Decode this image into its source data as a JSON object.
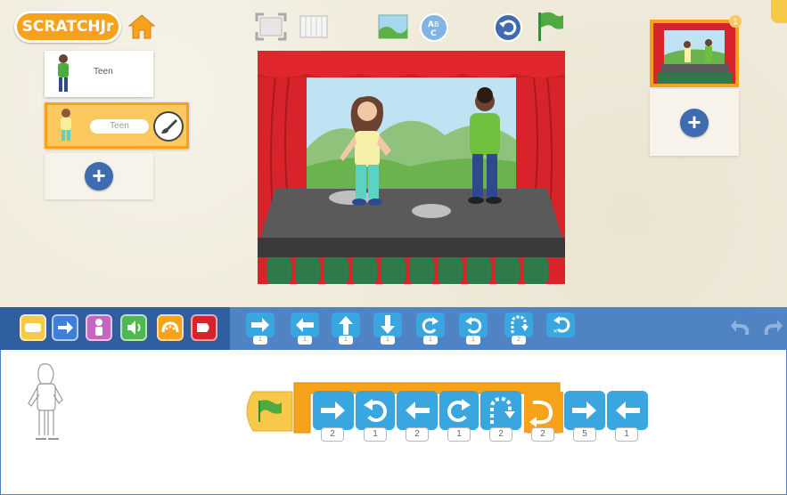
{
  "app": {
    "logo_text": "SCRATCHJr"
  },
  "toolbar": {
    "icons": [
      "home-icon",
      "fullscreen-icon",
      "grid-icon",
      "background-icon",
      "text-icon",
      "reset-icon",
      "green-flag-icon"
    ]
  },
  "sprites": {
    "items": [
      {
        "label": "Teen",
        "selected": false
      },
      {
        "label": "Teen",
        "selected": true
      }
    ]
  },
  "pages": {
    "current_page": "1"
  },
  "palette": {
    "categories": [
      {
        "name": "triggering-blocks",
        "color": "#f7c948"
      },
      {
        "name": "motion-blocks",
        "color": "#3f7fd8"
      },
      {
        "name": "looks-blocks",
        "color": "#c466c2"
      },
      {
        "name": "sound-blocks",
        "color": "#52b651"
      },
      {
        "name": "control-blocks",
        "color": "#f7a21b"
      },
      {
        "name": "end-blocks",
        "color": "#d9232a"
      }
    ],
    "blocks": [
      {
        "name": "move-right",
        "count": "1"
      },
      {
        "name": "move-left",
        "count": "1"
      },
      {
        "name": "move-up",
        "count": "1"
      },
      {
        "name": "move-down",
        "count": "1"
      },
      {
        "name": "turn-right",
        "count": "1"
      },
      {
        "name": "turn-left",
        "count": "1"
      },
      {
        "name": "hop",
        "count": "2"
      },
      {
        "name": "go-home",
        "count": ""
      }
    ]
  },
  "script": {
    "repeat_count": "2",
    "blocks": [
      {
        "name": "move-right",
        "count": "2"
      },
      {
        "name": "turn-left",
        "count": "1"
      },
      {
        "name": "move-left",
        "count": "2"
      },
      {
        "name": "turn-right",
        "count": "1"
      },
      {
        "name": "hop",
        "count": "2"
      },
      {
        "name": "move-right",
        "count": "5"
      },
      {
        "name": "move-left",
        "count": "1"
      }
    ]
  },
  "colors": {
    "motion_blue": "#3aa6e0",
    "palette_bar": "#4f83c4",
    "control_orange": "#f7a21b",
    "trigger_yellow": "#f7c948"
  }
}
